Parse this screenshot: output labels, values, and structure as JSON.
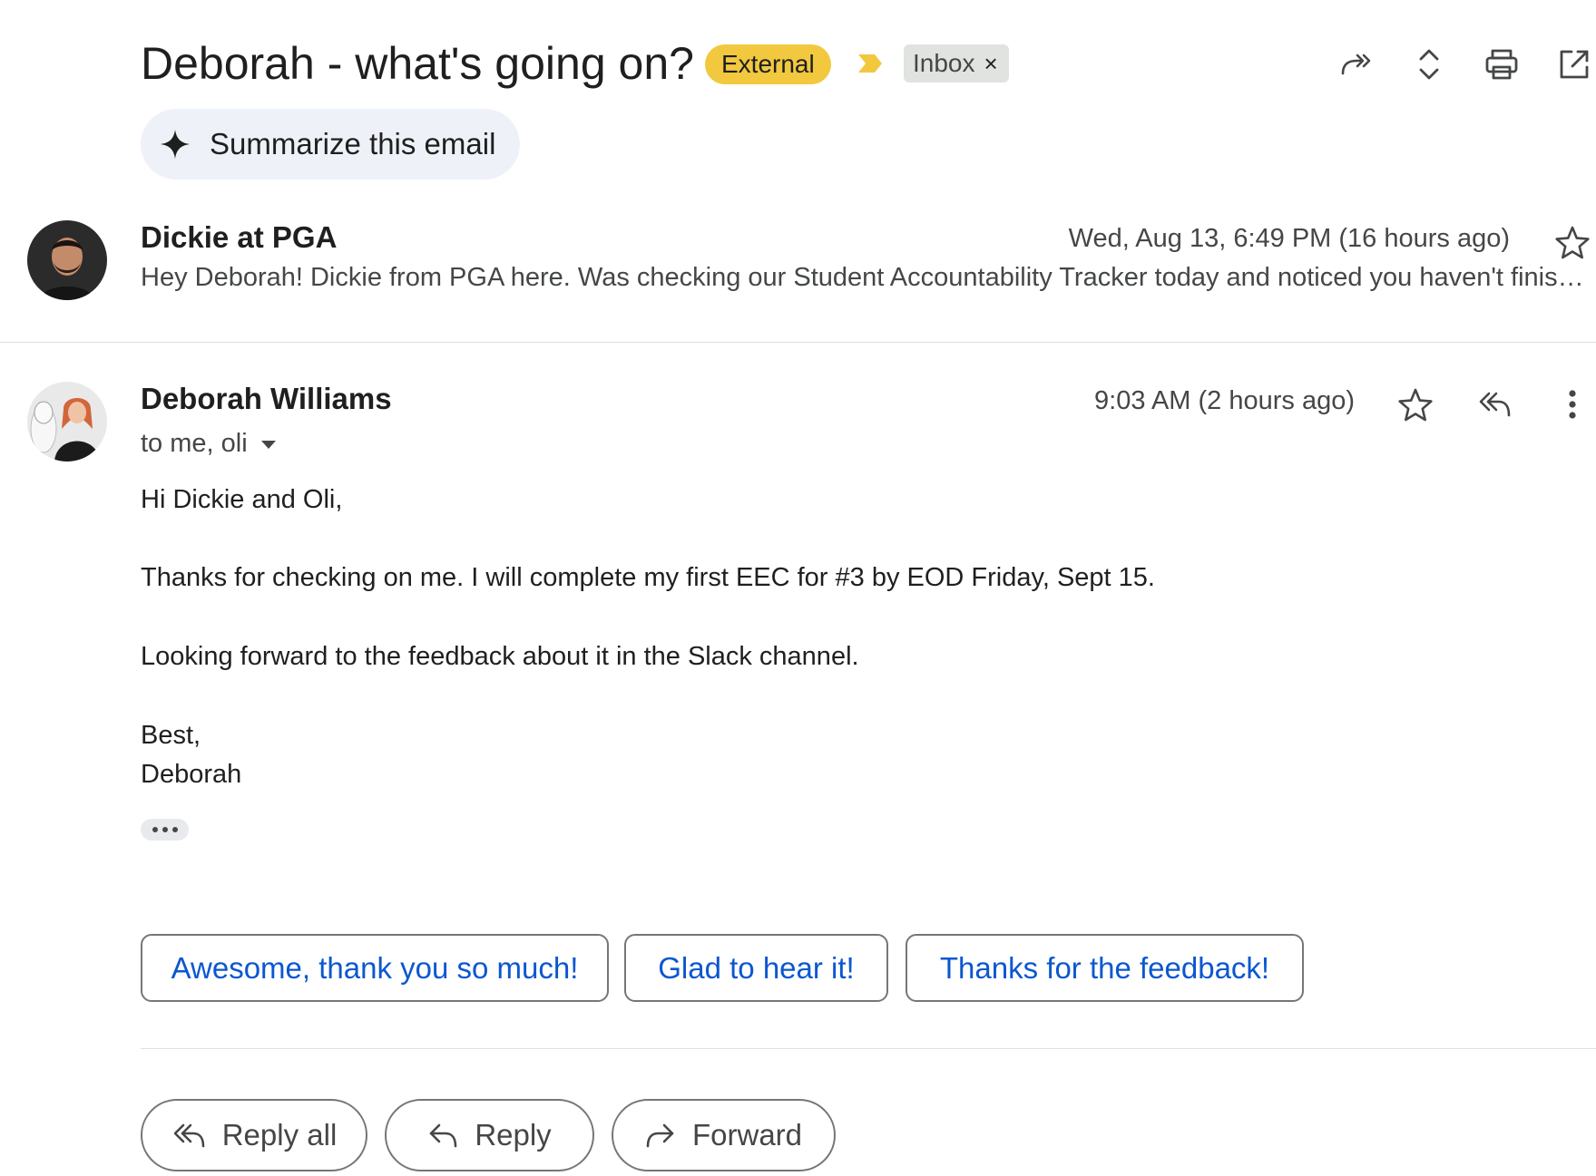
{
  "subject": {
    "title": "Deborah - what's going on?",
    "external_label": "External",
    "inbox_label": "Inbox",
    "inbox_remove": "×",
    "colors": {
      "external_chip": "#f2c83f",
      "importance_marker": "#f2c83f",
      "inbox_chip": "#e1e3e1"
    }
  },
  "header_actions": [
    {
      "icon": "reply-all-forward-icon"
    },
    {
      "icon": "expand-collapse-icon"
    },
    {
      "icon": "print-icon"
    },
    {
      "icon": "open-in-new-window-icon"
    }
  ],
  "summarize": {
    "label": "Summarize this email",
    "icon": "sparkle-icon"
  },
  "messages": [
    {
      "sender": "Dickie at PGA",
      "timestamp": "Wed, Aug 13, 6:49 PM (16 hours ago)",
      "snippet": "Hey Deborah! Dickie from PGA here. Was checking our Student Accountability Tracker today and noticed you haven't finished your first EEC yet",
      "starred": false
    },
    {
      "sender": "Deborah Williams",
      "timestamp": "9:03 AM (2 hours ago)",
      "recipients": "to me, oli",
      "starred": false,
      "body": [
        "Hi Dickie and Oli,",
        "Thanks for checking on me. I will complete my first EEC for #3 by EOD Friday, Sept 15.",
        "Looking forward to the feedback about it in the Slack channel.",
        "Best,",
        "Deborah"
      ]
    }
  ],
  "smart_replies": [
    "Awesome, thank you so much!",
    "Glad to hear it!",
    "Thanks for the feedback!"
  ],
  "actions": {
    "reply_all": "Reply all",
    "reply": "Reply",
    "forward": "Forward"
  },
  "colors": {
    "link_blue": "#0b57d0",
    "border_gray": "#747775",
    "text_secondary": "#444746"
  }
}
